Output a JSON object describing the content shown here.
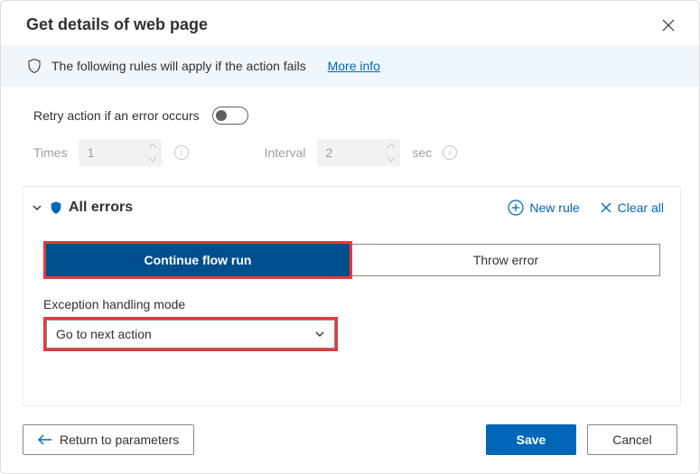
{
  "header": {
    "title": "Get details of web page"
  },
  "notice": {
    "text": "The following rules will apply if the action fails",
    "more_info": "More info"
  },
  "retry": {
    "label": "Retry action if an error occurs",
    "on": false,
    "times_label": "Times",
    "times_value": "1",
    "interval_label": "Interval",
    "interval_value": "2",
    "interval_unit": "sec"
  },
  "errors_section": {
    "title": "All errors",
    "new_rule": "New rule",
    "clear_all": "Clear all",
    "segmented": {
      "continue": "Continue flow run",
      "throw": "Throw error",
      "active": "continue"
    },
    "mode_label": "Exception handling mode",
    "mode_value": "Go to next action"
  },
  "footer": {
    "return": "Return to parameters",
    "save": "Save",
    "cancel": "Cancel"
  }
}
